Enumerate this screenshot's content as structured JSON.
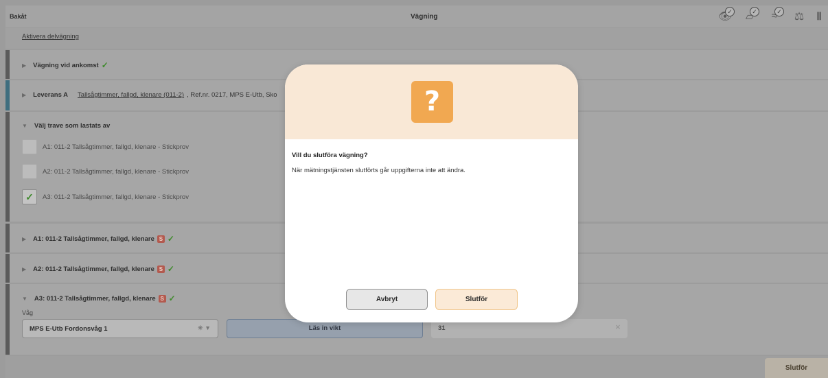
{
  "header": {
    "back_label": "Bakåt",
    "title": "Vägning",
    "icons": [
      "eye-check-icon",
      "document-check-icon",
      "approx-check-icon",
      "scale-icon",
      "barcode-icon"
    ]
  },
  "partial_weighing": {
    "label": "Aktivera delvägning"
  },
  "sections": {
    "arrival": {
      "label": "Vägning vid ankomst"
    },
    "delivery": {
      "label": "Leverans A",
      "link": "Tallsågtimmer, fallgd, klenare (011-2)",
      "rest": ", Ref.nr. 0217, MPS E-Utb, Sko"
    },
    "choose_pile": {
      "label": "Välj trave som lastats av",
      "items": [
        {
          "label": "A1: 011-2 Tallsågtimmer, fallgd, klenare - Stickprov",
          "checked": false
        },
        {
          "label": "A2: 011-2 Tallsågtimmer, fallgd, klenare - Stickprov",
          "checked": false
        },
        {
          "label": "A3: 011-2 Tallsågtimmer, fallgd, klenare - Stickprov",
          "checked": true
        }
      ]
    },
    "a1": {
      "label": "A1: 011-2 Tallsågtimmer, fallgd, klenare",
      "badge": "S"
    },
    "a2": {
      "label": "A2: 011-2 Tallsågtimmer, fallgd, klenare",
      "badge": "S"
    },
    "a3": {
      "label": "A3: 011-2 Tallsågtimmer, fallgd, klenare",
      "badge": "S",
      "scale_label": "Våg",
      "scale_value": "MPS E-Utb Fordonsvåg 1",
      "read_button": "Läs in vikt",
      "weight_value": "31"
    }
  },
  "footer": {
    "finish_label": "Slutför"
  },
  "dialog": {
    "title": "Vill du slutföra vägning?",
    "message": "När mätningstjänsten slutförts går uppgifterna inte att ändra.",
    "cancel_label": "Avbryt",
    "confirm_label": "Slutför",
    "icon_glyph": "?"
  },
  "colors": {
    "accent_orange": "#f1a851",
    "dialog_header": "#f9e8d6",
    "check_green": "#3f8a2c",
    "badge_red": "#b35a4f"
  }
}
